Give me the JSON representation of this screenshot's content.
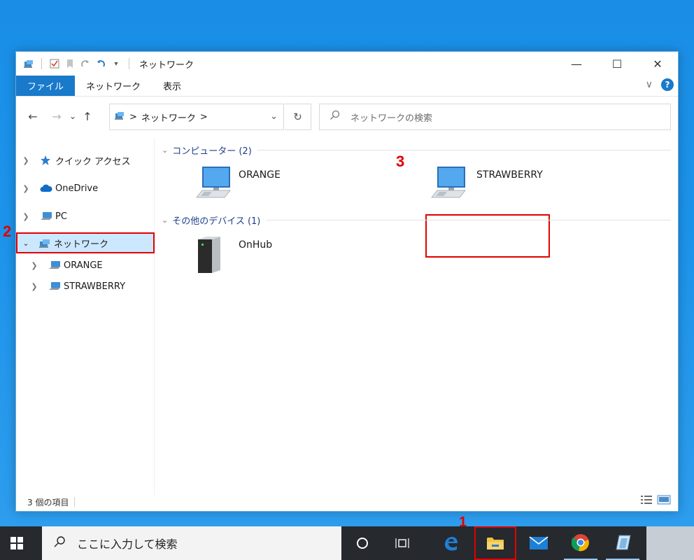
{
  "window": {
    "title": "ネットワーク",
    "controls": {
      "minimize": "—",
      "maximize": "☐",
      "close": "✕"
    }
  },
  "ribbon": {
    "tabs": [
      "ファイル",
      "ネットワーク",
      "表示"
    ],
    "expand_glyph": "∨",
    "help_glyph": "?"
  },
  "address_bar": {
    "back": "←",
    "forward": "→",
    "recent": "⌄",
    "up": "↑",
    "path": "ネットワーク",
    "sep": ">",
    "dropdown": "⌄",
    "refresh": "↻"
  },
  "search": {
    "placeholder": "ネットワークの検索"
  },
  "nav_pane": {
    "items": [
      {
        "label": "クイック アクセス",
        "expanded": false,
        "icon": "star-icon"
      },
      {
        "label": "OneDrive",
        "expanded": false,
        "icon": "cloud-icon"
      },
      {
        "label": "PC",
        "expanded": false,
        "icon": "pc-icon"
      },
      {
        "label": "ネットワーク",
        "expanded": true,
        "selected": true,
        "icon": "network-icon"
      },
      {
        "label": "ORANGE",
        "expanded": false,
        "icon": "computer-icon"
      },
      {
        "label": "STRAWBERRY",
        "expanded": false,
        "icon": "computer-icon"
      }
    ]
  },
  "content": {
    "groups": [
      {
        "header": "コンピューター (2)",
        "items": [
          {
            "label": "ORANGE",
            "icon": "computer-icon"
          },
          {
            "label": "STRAWBERRY",
            "icon": "computer-icon"
          }
        ]
      },
      {
        "header": "その他のデバイス (1)",
        "items": [
          {
            "label": "OnHub",
            "icon": "device-icon"
          }
        ]
      }
    ]
  },
  "status_bar": {
    "item_count": "3 個の項目"
  },
  "taskbar": {
    "search_placeholder": "ここに入力して検索"
  },
  "callouts": [
    "1",
    "2",
    "3"
  ],
  "colors": {
    "highlight_red": "#e00000",
    "accent_blue": "#1979ca",
    "selection": "#cce8ff"
  }
}
